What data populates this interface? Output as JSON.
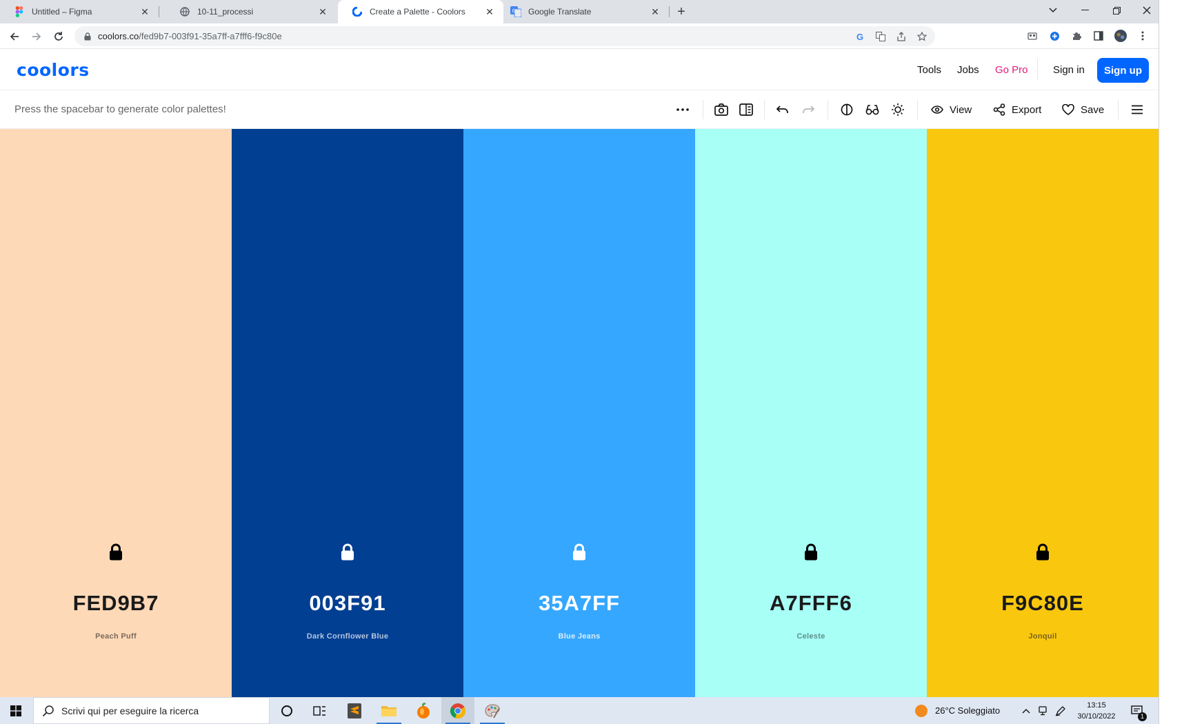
{
  "browser": {
    "tabs": [
      {
        "title": "Untitled – Figma",
        "icon": "figma-icon",
        "active": false
      },
      {
        "title": "10-11_processi",
        "icon": "globe-icon",
        "active": false
      },
      {
        "title": "Create a Palette - Coolors",
        "icon": "coolors-icon",
        "active": true
      },
      {
        "title": "Google Translate",
        "icon": "google-translate-icon",
        "active": false
      }
    ],
    "url_host": "coolors.co",
    "url_path": "/fed9b7-003f91-35a7ff-a7fff6-f9c80e"
  },
  "header": {
    "logo": "coolors",
    "nav": {
      "tools": "Tools",
      "jobs": "Jobs",
      "gopro": "Go Pro",
      "signin": "Sign in",
      "signup": "Sign up"
    }
  },
  "toolbar": {
    "hint": "Press the spacebar to generate color palettes!",
    "view": "View",
    "export": "Export",
    "save": "Save"
  },
  "palette": [
    {
      "hex": "FED9B7",
      "name": "Peach Puff",
      "bg": "#fed9b7",
      "text": "#1a1a1a",
      "subtext": "#7a6a5c",
      "lock_color": "#000000"
    },
    {
      "hex": "003F91",
      "name": "Dark Cornflower Blue",
      "bg": "#003f91",
      "text": "#ffffff",
      "subtext": "#b7c6e3",
      "lock_color": "#ffffff"
    },
    {
      "hex": "35A7FF",
      "name": "Blue Jeans",
      "bg": "#35a7ff",
      "text": "#ffffff",
      "subtext": "#d8edff",
      "lock_color": "#ffffff"
    },
    {
      "hex": "A7FFF6",
      "name": "Celeste",
      "bg": "#a7fff6",
      "text": "#1a1a1a",
      "subtext": "#5f8f8a",
      "lock_color": "#000000"
    },
    {
      "hex": "F9C80E",
      "name": "Jonquil",
      "bg": "#f9c80e",
      "text": "#1a1a1a",
      "subtext": "#7a6220",
      "lock_color": "#000000"
    }
  ],
  "taskbar": {
    "search_placeholder": "Scrivi qui per eseguire la ricerca",
    "weather": "26°C  Soleggiato",
    "time": "13:15",
    "date": "30/10/2022",
    "notification_count": "1"
  },
  "colors": {
    "accent": "#0066ff",
    "gopro": "#e5187a"
  }
}
